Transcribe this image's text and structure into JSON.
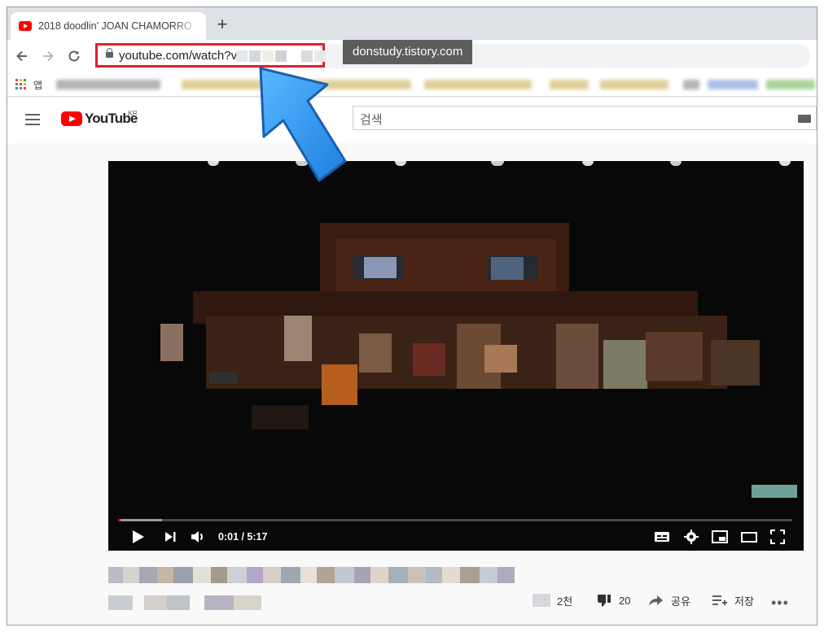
{
  "browser": {
    "tab": {
      "title": "2018 doodlin' JOAN CHAMORRO"
    },
    "address": {
      "url_visible": "youtube.com/watch?v="
    },
    "watermark": "donstudy.tistory.com",
    "bookmarks": {
      "apps_label": "앱"
    }
  },
  "youtube": {
    "logo_text": "YouTube",
    "region": "KR",
    "search_placeholder": "검색"
  },
  "player": {
    "time": "0:01 / 5:17",
    "played_fraction": 0.0032,
    "buffered_fraction": 0.065
  },
  "actions": {
    "likes": "2천",
    "dislikes": "20",
    "share": "공유",
    "save": "저장"
  },
  "colors": {
    "highlight": "#e0202e",
    "annotation_arrow": "#1e90ff",
    "youtube_red": "#ff0000"
  }
}
